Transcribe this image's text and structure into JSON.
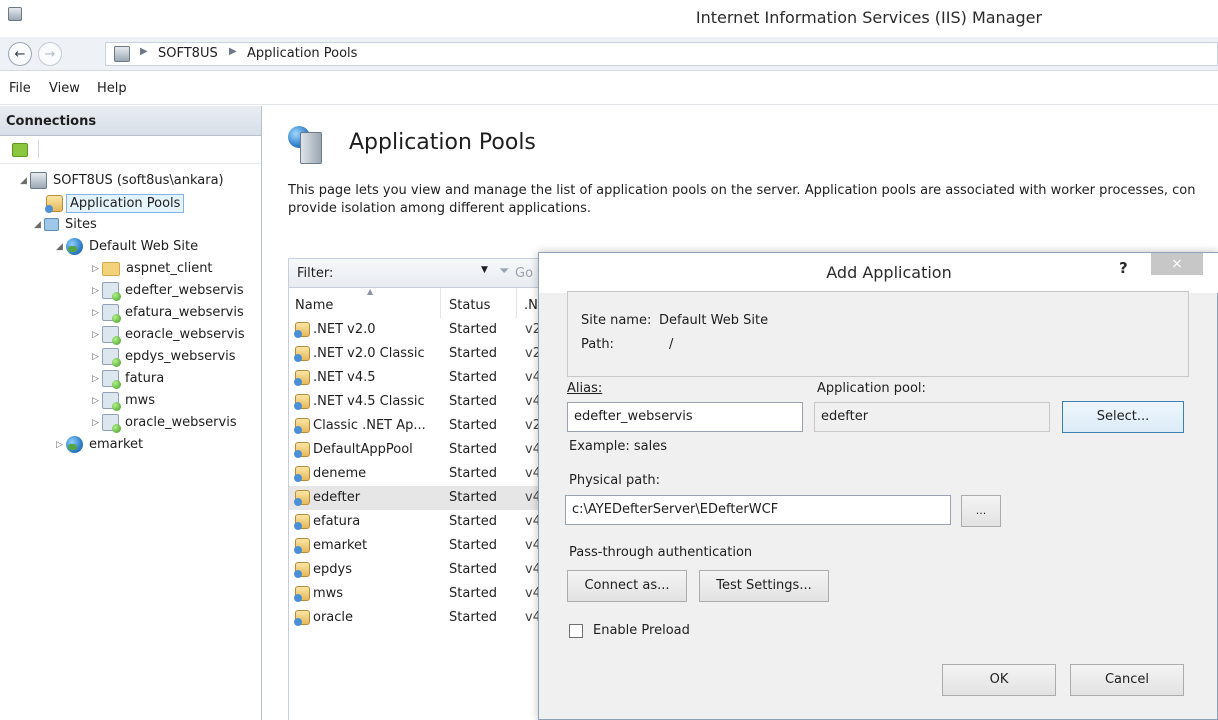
{
  "window": {
    "title": "Internet Information Services (IIS) Manager"
  },
  "address": {
    "crumbs": [
      "SOFT8US",
      "Application Pools"
    ]
  },
  "menu": {
    "items": [
      "File",
      "View",
      "Help"
    ]
  },
  "connections": {
    "header": "Connections",
    "tree": {
      "server": "SOFT8US (soft8us\\ankara)",
      "app_pools": "Application Pools",
      "sites": "Sites",
      "default_site": "Default Web Site",
      "children": [
        "aspnet_client",
        "edefter_webservis",
        "efatura_webservis",
        "eoracle_webservis",
        "epdys_webservis",
        "fatura",
        "mws",
        "oracle_webservis"
      ],
      "emarket": "emarket"
    }
  },
  "main": {
    "title": "Application Pools",
    "description": "This page lets you view and manage the list of application pools on the server. Application pools are associated with worker processes, con provide isolation among different applications.",
    "filter_label": "Filter:",
    "go_label": "Go",
    "columns": {
      "name": "Name",
      "status": "Status",
      "version": ".N"
    },
    "pools": [
      {
        "name": ".NET v2.0",
        "status": "Started",
        "version": "v2"
      },
      {
        "name": ".NET v2.0 Classic",
        "status": "Started",
        "version": "v2"
      },
      {
        "name": ".NET v4.5",
        "status": "Started",
        "version": "v4"
      },
      {
        "name": ".NET v4.5 Classic",
        "status": "Started",
        "version": "v4"
      },
      {
        "name": "Classic .NET Ap...",
        "status": "Started",
        "version": "v2"
      },
      {
        "name": "DefaultAppPool",
        "status": "Started",
        "version": "v4"
      },
      {
        "name": "deneme",
        "status": "Started",
        "version": "v4"
      },
      {
        "name": "edefter",
        "status": "Started",
        "version": "v4"
      },
      {
        "name": "efatura",
        "status": "Started",
        "version": "v4"
      },
      {
        "name": "emarket",
        "status": "Started",
        "version": "v4"
      },
      {
        "name": "epdys",
        "status": "Started",
        "version": "v4"
      },
      {
        "name": "mws",
        "status": "Started",
        "version": "v4"
      },
      {
        "name": "oracle",
        "status": "Started",
        "version": "v4"
      }
    ]
  },
  "dialog": {
    "title": "Add Application",
    "help": "?",
    "close": "×",
    "site_name_label": "Site name:",
    "site_name_value": "Default Web Site",
    "path_label": "Path:",
    "path_value": "/",
    "alias_label": "Alias:",
    "alias_value": "edefter_webservis",
    "example": "Example: sales",
    "app_pool_label": "Application pool:",
    "app_pool_value": "edefter",
    "select_button": "Select...",
    "physical_path_label": "Physical path:",
    "physical_path_value": "c:\\AYEDefterServer\\EDefterWCF",
    "browse_button": "...",
    "passthrough_label": "Pass-through authentication",
    "connect_as_button": "Connect as...",
    "test_settings_button": "Test Settings...",
    "enable_preload_label": "Enable Preload",
    "ok_button": "OK",
    "cancel_button": "Cancel"
  }
}
